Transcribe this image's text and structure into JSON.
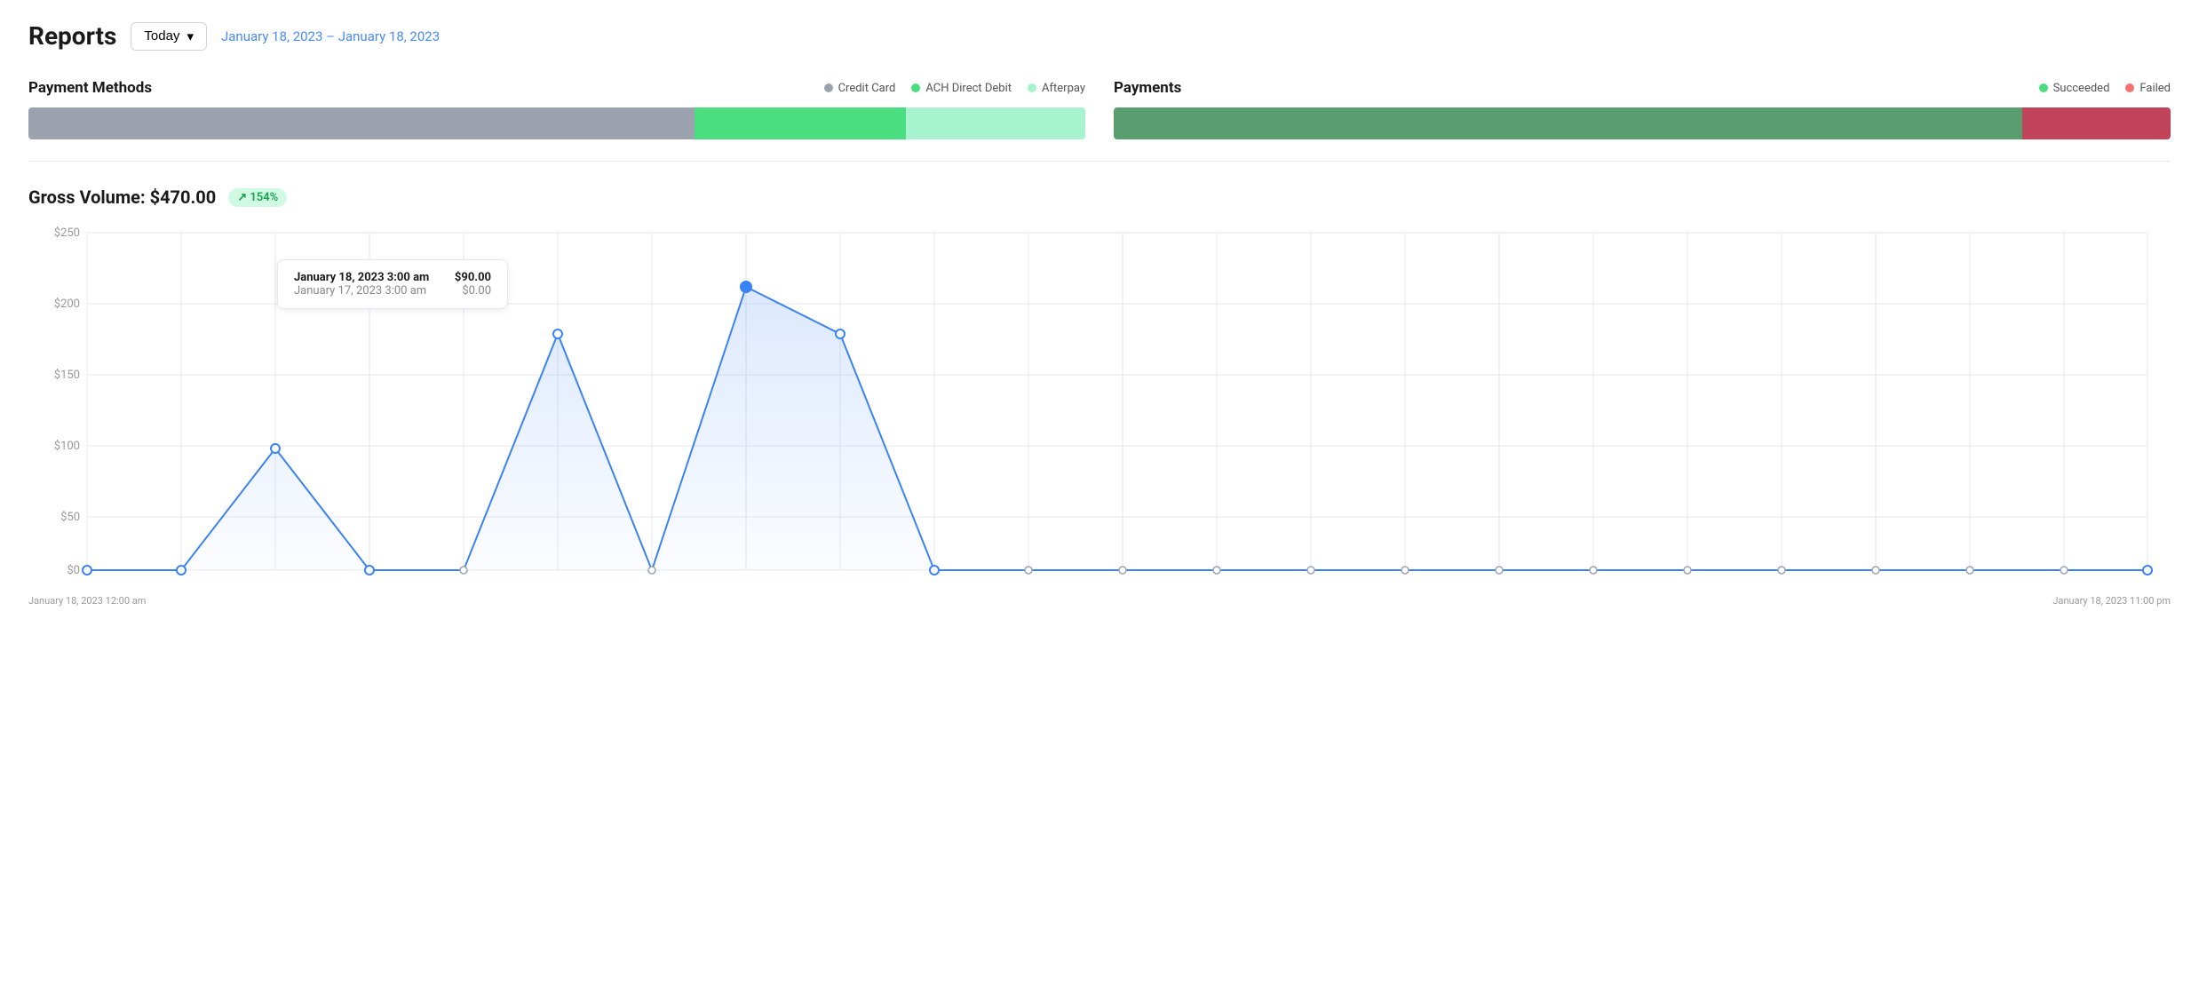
{
  "header": {
    "title": "Reports",
    "dropdown_label": "Today",
    "date_range": "January 18, 2023 – January 18, 2023"
  },
  "payment_methods": {
    "title": "Payment Methods",
    "legend": [
      {
        "label": "Credit Card",
        "color": "#9ca3af"
      },
      {
        "label": "ACH Direct Debit",
        "color": "#4ade80"
      },
      {
        "label": "Afterpay",
        "color": "#a7f3d0"
      }
    ],
    "bar_segments": [
      {
        "label": "Credit Card",
        "color": "#9ca3af",
        "pct": 63
      },
      {
        "label": "ACH Direct Debit",
        "color": "#4ade80",
        "pct": 20
      },
      {
        "label": "Afterpay",
        "color": "#a7f3d0",
        "pct": 17
      }
    ]
  },
  "payments": {
    "title": "Payments",
    "legend": [
      {
        "label": "Succeeded",
        "color": "#4ade80"
      },
      {
        "label": "Failed",
        "color": "#f87171"
      }
    ],
    "bar_segments": [
      {
        "label": "Succeeded",
        "color": "#5a9e6f",
        "pct": 86
      },
      {
        "label": "Failed",
        "color": "#c0435a",
        "pct": 14
      }
    ]
  },
  "gross_volume": {
    "label": "Gross Volume: $470.00",
    "badge": "↗ 154%"
  },
  "chart": {
    "y_labels": [
      "$250",
      "$200",
      "$150",
      "$100",
      "$50",
      "$0"
    ],
    "x_labels": [
      "January 18, 2023 12:00 am",
      "January 18, 2023 11:00 pm"
    ],
    "tooltip": {
      "row1_date": "January 18, 2023 3:00 am",
      "row1_value": "$90.00",
      "row2_date": "January 17, 2023 3:00 am",
      "row2_value": "$0.00"
    }
  }
}
